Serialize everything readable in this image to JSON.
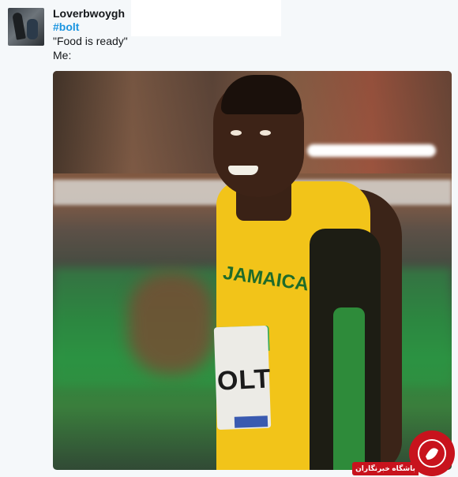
{
  "tweet": {
    "username": "Loverbwoygh",
    "hashtag": "#bolt",
    "line1": "\"Food is ready\"",
    "line2": "Me:"
  },
  "media": {
    "bib_name": "OLT",
    "jersey_text": "JAMAICA"
  },
  "watermark": {
    "text": "باشگاه خبرنگاران",
    "color": "#c8131d"
  },
  "colors": {
    "hashtag": "#1b95e0",
    "background": "#f5f8fa"
  }
}
